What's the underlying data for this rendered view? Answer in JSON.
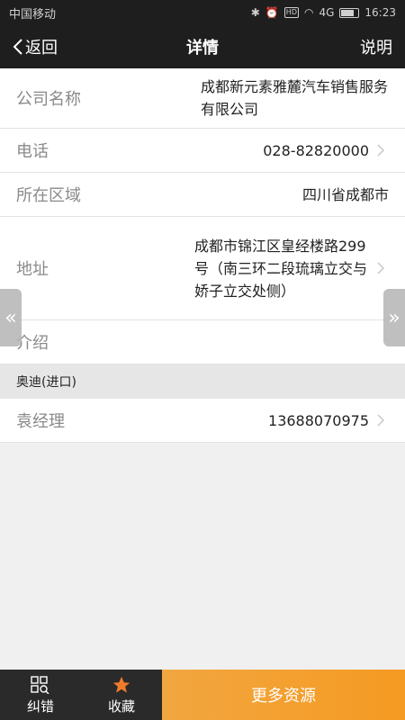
{
  "status": {
    "carrier": "中国移动",
    "time": "16:23",
    "hd": "HD",
    "signal": "4G"
  },
  "nav": {
    "back_label": "返回",
    "title": "详情",
    "help_label": "说明"
  },
  "company_row": {
    "label": "公司名称",
    "value": "成都新元素雅麓汽车销售服务有限公司"
  },
  "phone_row": {
    "label": "电话",
    "value": "028-82820000"
  },
  "region_row": {
    "label": "所在区域",
    "value": "四川省成都市"
  },
  "address_row": {
    "label": "地址",
    "value": "成都市锦江区皇经楼路299号（南三环二段琉璃立交与娇子立交处侧）"
  },
  "intro_row": {
    "label": "介绍",
    "value": ""
  },
  "section": {
    "title": "奥迪(进口)"
  },
  "contact_row": {
    "label": "袁经理",
    "value": "13688070975"
  },
  "side": {
    "left_arrow": "«",
    "right_arrow": "»"
  },
  "bottom": {
    "report_label": "纠错",
    "favorite_label": "收藏",
    "more_label": "更多资源"
  },
  "colors": {
    "accent": "#f59a22",
    "dark": "#1e1e1e",
    "star": "#f07b2a"
  }
}
